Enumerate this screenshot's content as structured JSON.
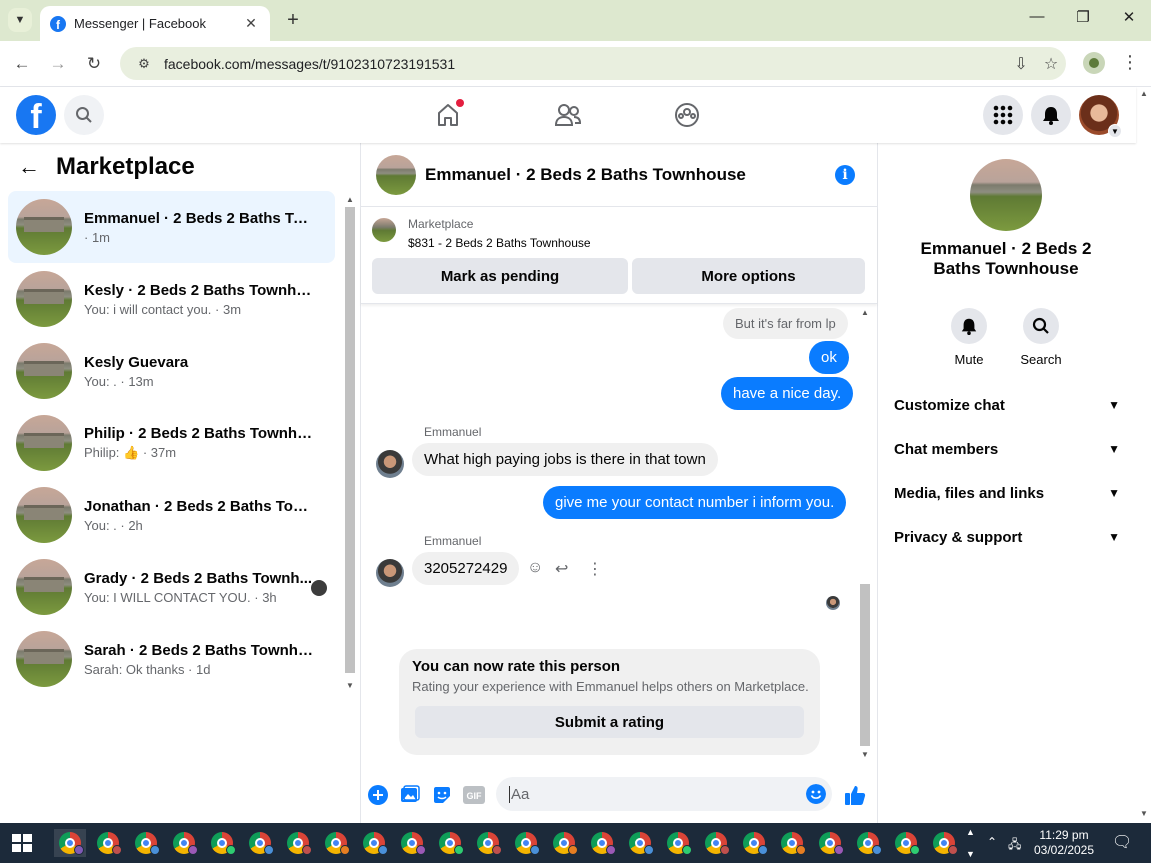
{
  "browser": {
    "tab_title": "Messenger | Facebook",
    "url": "facebook.com/messages/t/9102310723191531"
  },
  "left_panel": {
    "title": "Marketplace",
    "conversations": [
      {
        "name": "Emmanuel · 2 Beds 2 Baths Tow...",
        "sub": "· 1m",
        "active": true
      },
      {
        "name": "Kesly · 2 Beds 2 Baths Townhouse",
        "sub": "You: i will contact you. · 3m"
      },
      {
        "name": "Kesly Guevara",
        "sub": "You: . · 13m"
      },
      {
        "name": "Philip · 2 Beds 2 Baths Townhouse",
        "sub_prefix": "Philip: ",
        "sub_icon": "thumbs-up-icon",
        "sub_suffix": " · 37m"
      },
      {
        "name": "Jonathan · 2 Beds 2 Baths Town...",
        "sub": "You: . · 2h"
      },
      {
        "name": "Grady · 2 Beds 2 Baths Townh...",
        "sub": "You: I WILL CONTACT YOU. · 3h"
      },
      {
        "name": "Sarah · 2 Beds 2 Baths Townhouse",
        "sub": "Sarah: Ok thanks · 1d"
      }
    ]
  },
  "chat": {
    "title": "Emmanuel · 2 Beds 2 Baths Townhouse",
    "marketplace_label": "Marketplace",
    "listing": "$831 - 2 Beds 2 Baths Townhouse",
    "mark_pending": "Mark as pending",
    "more_options": "More options",
    "messages": {
      "m1": "But it's far from lp",
      "m2": "ok",
      "m3": "have a nice day.",
      "sender1": "Emmanuel",
      "m4": "What high paying jobs is there in that town",
      "m5": "give me your contact number i inform you.",
      "sender2": "Emmanuel",
      "m6": "3205272429"
    },
    "rate": {
      "title": "You can now rate this person",
      "subtitle": "Rating your experience with Emmanuel helps others on Marketplace.",
      "button": "Submit a rating"
    },
    "composer_placeholder": "Aa"
  },
  "right_panel": {
    "name": "Emmanuel · 2 Beds 2 Baths Townhouse",
    "mute": "Mute",
    "search": "Search",
    "sections": [
      "Customize chat",
      "Chat members",
      "Media, files and links",
      "Privacy & support"
    ]
  },
  "taskbar": {
    "time": "11:29 pm",
    "date": "03/02/2025"
  },
  "colors": {
    "facebook_blue": "#1877f2",
    "messenger_blue": "#0a7cff",
    "notification_red": "#e41e3f"
  }
}
